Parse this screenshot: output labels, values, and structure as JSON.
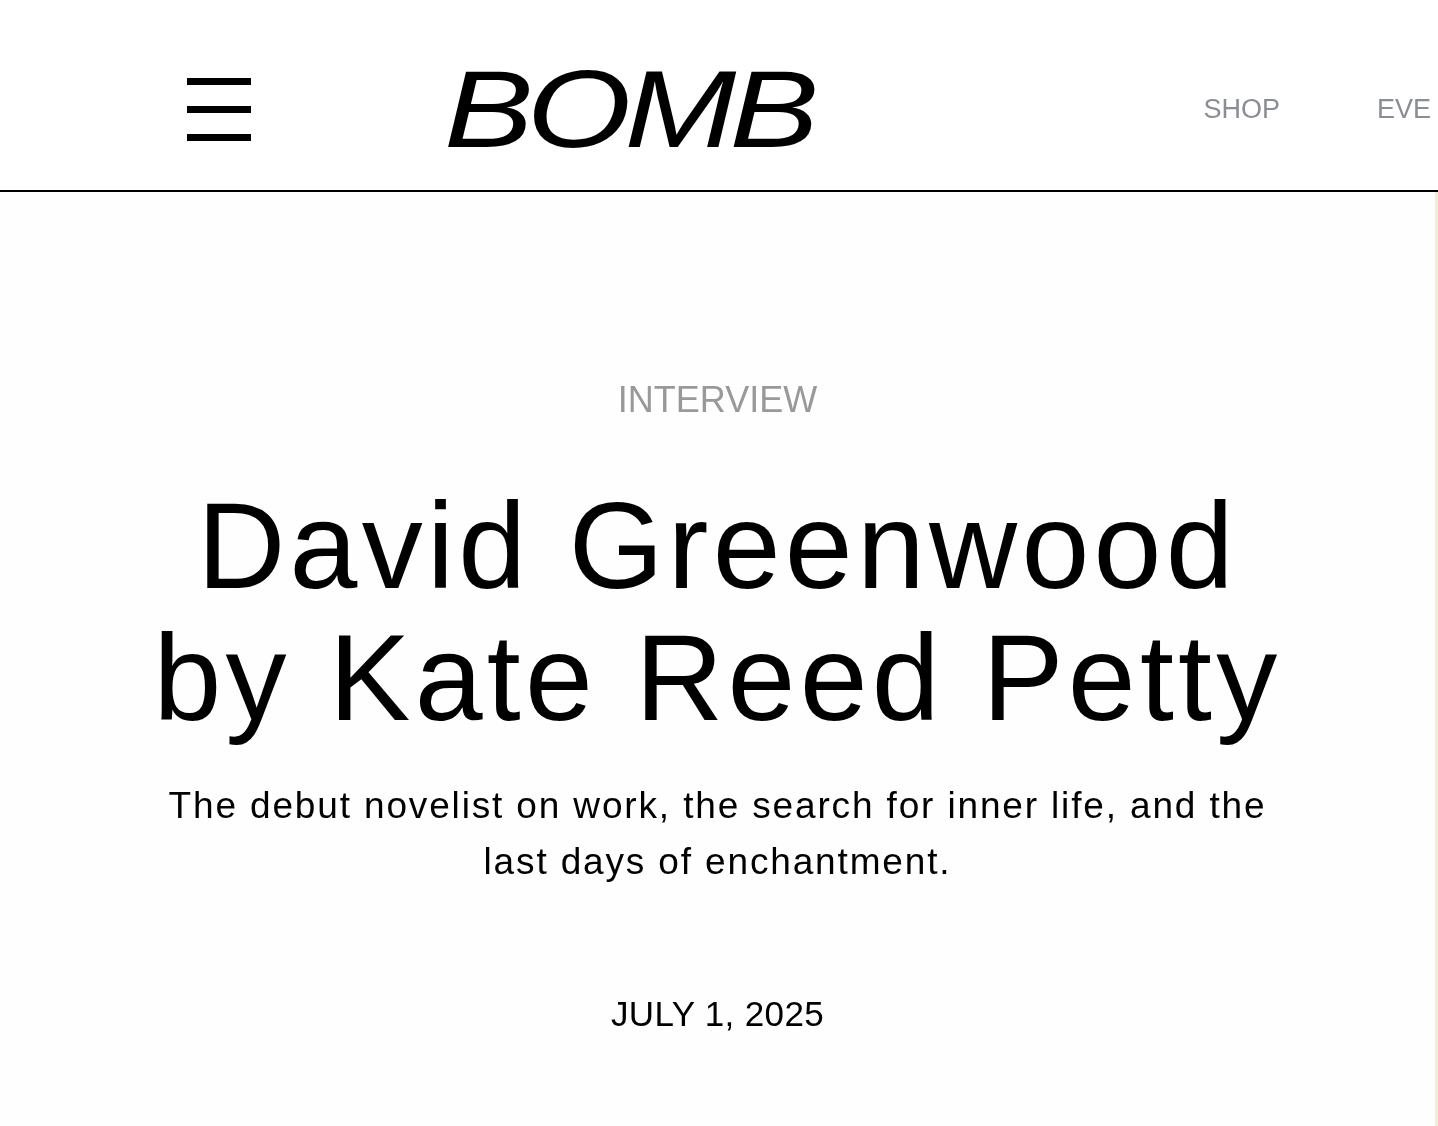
{
  "header": {
    "logo": "BOMB",
    "nav": [
      "SHOP",
      "EVE"
    ]
  },
  "article": {
    "category": "INTERVIEW",
    "title": "David Greenwood by Kate Reed Petty",
    "dek": "The debut novelist on work, the search for inner life, and the last days of enchantment.",
    "date": "JULY 1, 2025"
  }
}
